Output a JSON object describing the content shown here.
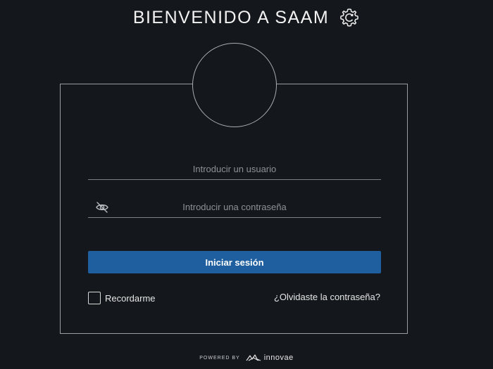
{
  "header": {
    "title": "BIENVENIDO A SAAM",
    "settings_icon": "gear-icon"
  },
  "login_form": {
    "username": {
      "placeholder": "Introducir un usuario",
      "value": ""
    },
    "password": {
      "placeholder": "Introducir una contraseña",
      "value": "",
      "visibility_icon": "eye-off-icon"
    },
    "submit_label": "Iniciar sesión",
    "remember_label": "Recordarme",
    "remember_checked": false,
    "forgot_label": "¿Olvidaste la contraseña?"
  },
  "footer": {
    "powered_by": "POWERED BY",
    "brand": "innovae"
  },
  "colors": {
    "background": "#14171c",
    "primary_button": "#1f5f9f",
    "border": "#9a9ea4"
  }
}
